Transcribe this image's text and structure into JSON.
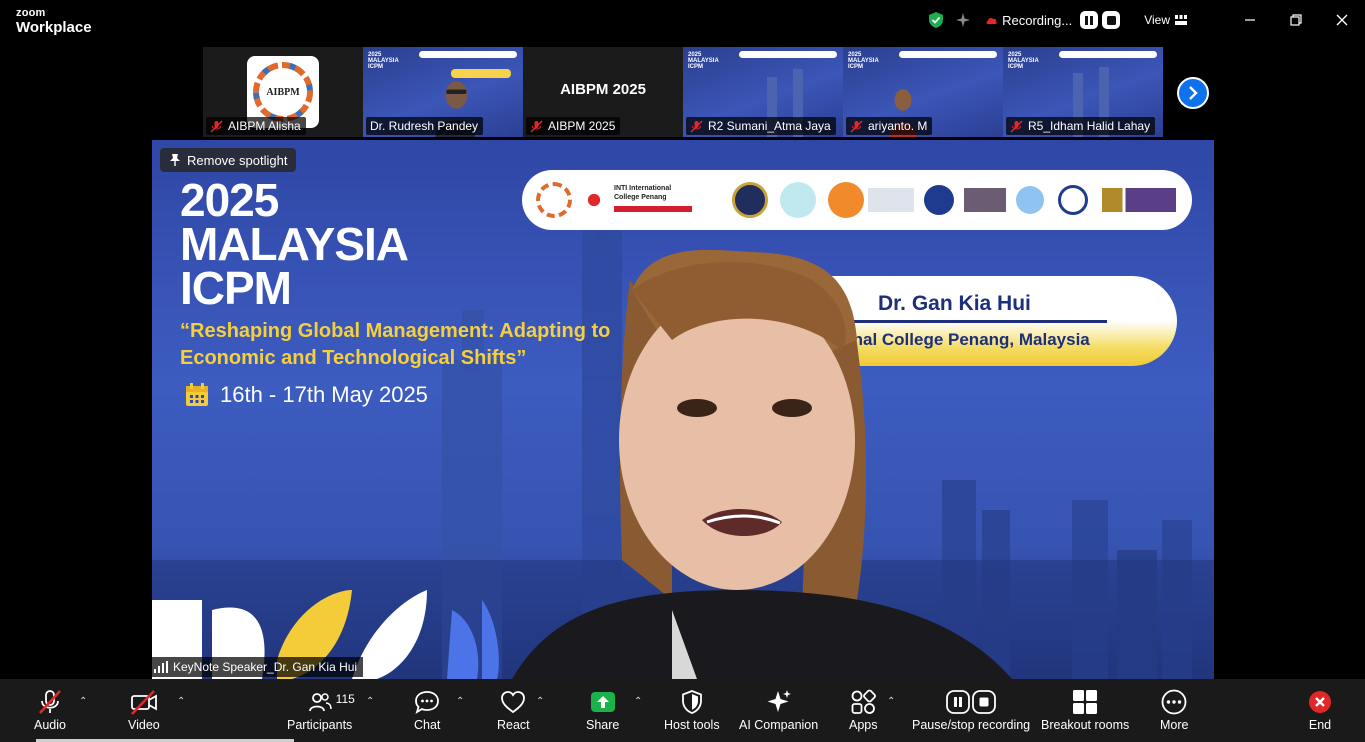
{
  "titlebar": {
    "brand_top": "zoom",
    "brand_bottom": "Workplace",
    "recording_label": "Recording...",
    "view_label": "View"
  },
  "thumbnails": [
    {
      "name": "AIBPM Alisha",
      "kind": "logo",
      "logo_text": "AIBPM"
    },
    {
      "name": "Dr. Rudresh Pandey",
      "kind": "slide-person"
    },
    {
      "name": "AIBPM 2025",
      "kind": "text",
      "center_text": "AIBPM 2025"
    },
    {
      "name": "R2 Sumani_Atma Jaya",
      "kind": "slide"
    },
    {
      "name": "ariyanto. M",
      "kind": "slide-person"
    },
    {
      "name": "R5_Idham Halid Lahay",
      "kind": "slide"
    }
  ],
  "thumb_slide_text": [
    "2025",
    "MALAYSIA",
    "ICPM"
  ],
  "main_view": {
    "spotlight_button": "Remove spotlight",
    "slide": {
      "year": "2025",
      "title_line1": "MALAYSIA",
      "title_line2": "ICPM",
      "theme": "“Reshaping Global Management: Adapting to Economic and Technological Shifts”",
      "date": "16th - 17th May 2025",
      "speaker_name": "Dr. Gan Kia Hui",
      "speaker_affiliation": "national College Penang, Malaysia",
      "logo_bar_text": "INTI International College Penang"
    },
    "active_speaker": "KeyNote Speaker_Dr. Gan Kia Hui"
  },
  "toolbar": {
    "audio": "Audio",
    "video": "Video",
    "participants": "Participants",
    "participant_count": "115",
    "chat": "Chat",
    "react": "React",
    "share": "Share",
    "host_tools": "Host tools",
    "ai_companion": "AI Companion",
    "apps": "Apps",
    "pause_stop_recording": "Pause/stop recording",
    "breakout_rooms": "Breakout rooms",
    "more": "More",
    "end": "End"
  },
  "colors": {
    "share_green": "#19b24b",
    "accent_blue": "#0e72ed",
    "end_red": "#e02828",
    "slide_yellow": "#f6cf3d",
    "shield_green": "#1fae4f"
  }
}
